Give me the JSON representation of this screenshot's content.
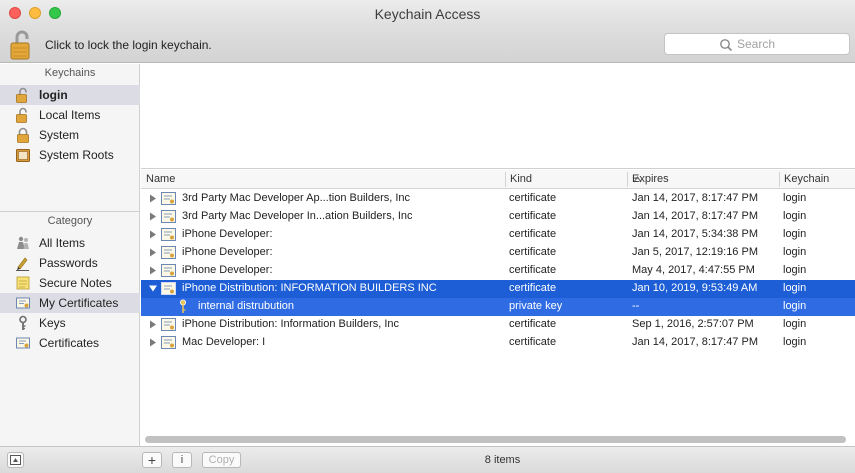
{
  "window": {
    "title": "Keychain Access"
  },
  "toolbar": {
    "lock_message": "Click to lock the login keychain.",
    "search_placeholder": "Search"
  },
  "sidebar": {
    "keychains_header": "Keychains",
    "keychains": [
      {
        "label": "login",
        "icon": "unlocked-lock-icon",
        "selected": true
      },
      {
        "label": "Local Items",
        "icon": "unlocked-lock-icon"
      },
      {
        "label": "System",
        "icon": "lock-icon"
      },
      {
        "label": "System Roots",
        "icon": "cabinet-icon"
      }
    ],
    "category_header": "Category",
    "categories": [
      {
        "label": "All Items",
        "icon": "people-icon"
      },
      {
        "label": "Passwords",
        "icon": "pen-icon"
      },
      {
        "label": "Secure Notes",
        "icon": "note-icon"
      },
      {
        "label": "My Certificates",
        "icon": "certificate-icon",
        "selected": true
      },
      {
        "label": "Keys",
        "icon": "key-icon"
      },
      {
        "label": "Certificates",
        "icon": "certificate-icon"
      }
    ]
  },
  "table": {
    "columns": {
      "name": "Name",
      "kind": "Kind",
      "expires": "Expires",
      "keychain": "Keychain"
    },
    "rows": [
      {
        "name": "3rd Party Mac Developer Ap...tion Builders, Inc",
        "kind": "certificate",
        "expires": "Jan 14, 2017, 8:17:47 PM",
        "keychain": "login"
      },
      {
        "name": "3rd Party Mac Developer In...ation Builders, Inc",
        "kind": "certificate",
        "expires": "Jan 14, 2017, 8:17:47 PM",
        "keychain": "login"
      },
      {
        "name": "iPhone Developer:",
        "kind": "certificate",
        "expires": "Jan 14, 2017, 5:34:38 PM",
        "keychain": "login"
      },
      {
        "name": "iPhone Developer:",
        "kind": "certificate",
        "expires": "Jan 5, 2017, 12:19:16 PM",
        "keychain": "login"
      },
      {
        "name": "iPhone Developer:",
        "kind": "certificate",
        "expires": "May 4, 2017, 4:47:55 PM",
        "keychain": "login"
      },
      {
        "name": "iPhone Distribution: INFORMATION BUILDERS INC",
        "kind": "certificate",
        "expires": "Jan 10, 2019, 9:53:49 AM",
        "keychain": "login",
        "selected": true,
        "expanded": true
      },
      {
        "name": "internal distrubution",
        "kind": "private key",
        "expires": "--",
        "keychain": "login",
        "child": true
      },
      {
        "name": "iPhone Distribution: Information Builders, Inc",
        "kind": "certificate",
        "expires": "Sep 1, 2016, 2:57:07 PM",
        "keychain": "login"
      },
      {
        "name": "Mac Developer: I",
        "kind": "certificate",
        "expires": "Jan 14, 2017, 8:17:47 PM",
        "keychain": "login"
      }
    ]
  },
  "bottombar": {
    "add_label": "+",
    "info_label": "i",
    "copy_label": "Copy",
    "item_count": "8 items"
  },
  "colors": {
    "selection": "#1d5ed6",
    "child_selection": "#2f6ce3",
    "close": "#fc605b",
    "minimize": "#fdbc40",
    "maximize": "#34c84a"
  }
}
